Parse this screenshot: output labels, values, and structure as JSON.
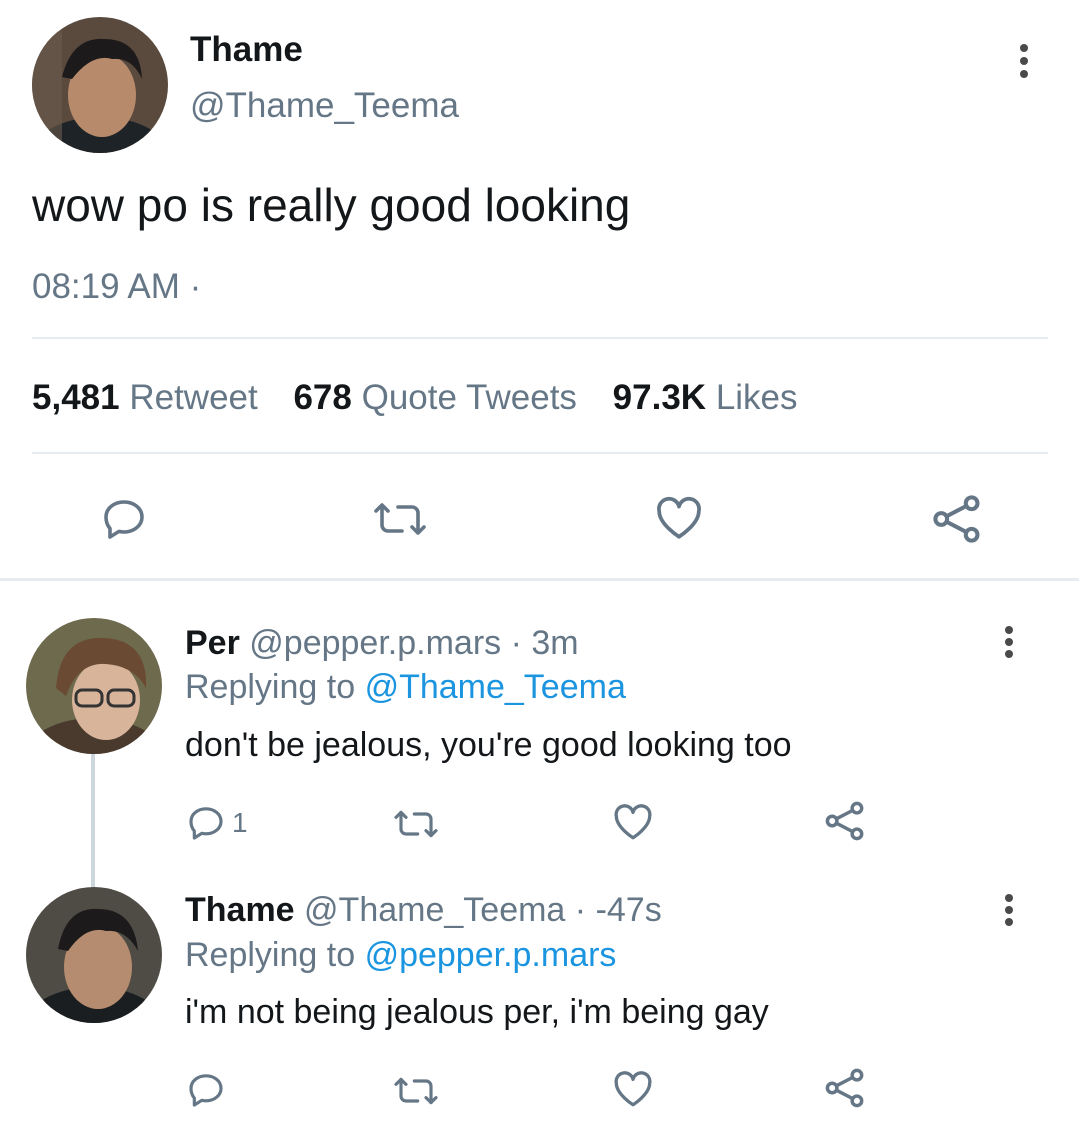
{
  "main_tweet": {
    "display_name": "Thame",
    "handle": "@Thame_Teema",
    "text": "wow po is really good looking",
    "time": "08:19 AM",
    "time_sep": "·",
    "stats": {
      "retweets_count": "5,481",
      "retweets_label": "Retweet",
      "quotes_count": "678",
      "quotes_label": "Quote Tweets",
      "likes_count": "97.3K",
      "likes_label": "Likes"
    }
  },
  "replies": [
    {
      "display_name": "Per",
      "handle": "@pepper.p.mars",
      "time": "· 3m",
      "replying_label": "Replying to",
      "replying_to": "@Thame_Teema",
      "text": "don't be jealous, you're good looking too",
      "reply_count": "1"
    },
    {
      "display_name": "Thame",
      "handle": "@Thame_Teema",
      "time": "· -47s",
      "replying_label": "Replying to",
      "replying_to": "@pepper.p.mars",
      "text": "i'm not being jealous per, i'm being gay",
      "reply_count": ""
    }
  ],
  "icons": [
    "reply-icon",
    "retweet-icon",
    "like-icon",
    "share-icon",
    "more-options-icon"
  ],
  "colors": {
    "link": "#1b95e0",
    "secondary_text": "#657786",
    "divider": "#e6ecf0"
  }
}
